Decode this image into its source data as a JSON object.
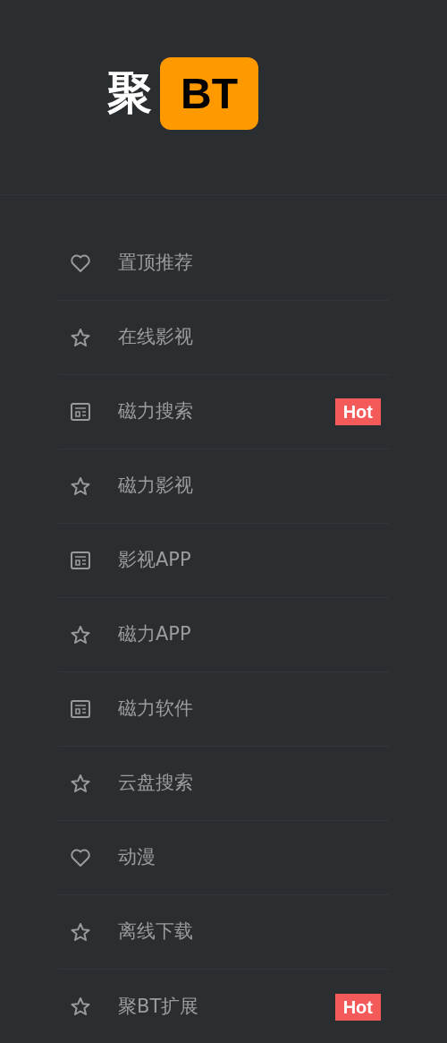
{
  "logo": {
    "text": "聚",
    "badge": "BT"
  },
  "menu": [
    {
      "label": "置顶推荐",
      "kind": "heart"
    },
    {
      "label": "在线影视",
      "kind": "star"
    },
    {
      "label": "磁力搜索",
      "kind": "news",
      "badge": "Hot"
    },
    {
      "label": "磁力影视",
      "kind": "star"
    },
    {
      "label": "影视APP",
      "kind": "news"
    },
    {
      "label": "磁力APP",
      "kind": "star"
    },
    {
      "label": "磁力软件",
      "kind": "news"
    },
    {
      "label": "云盘搜索",
      "kind": "star"
    },
    {
      "label": "动漫",
      "kind": "heart"
    },
    {
      "label": "离线下载",
      "kind": "star"
    },
    {
      "label": "聚BT扩展",
      "kind": "star",
      "badge": "Hot"
    }
  ]
}
